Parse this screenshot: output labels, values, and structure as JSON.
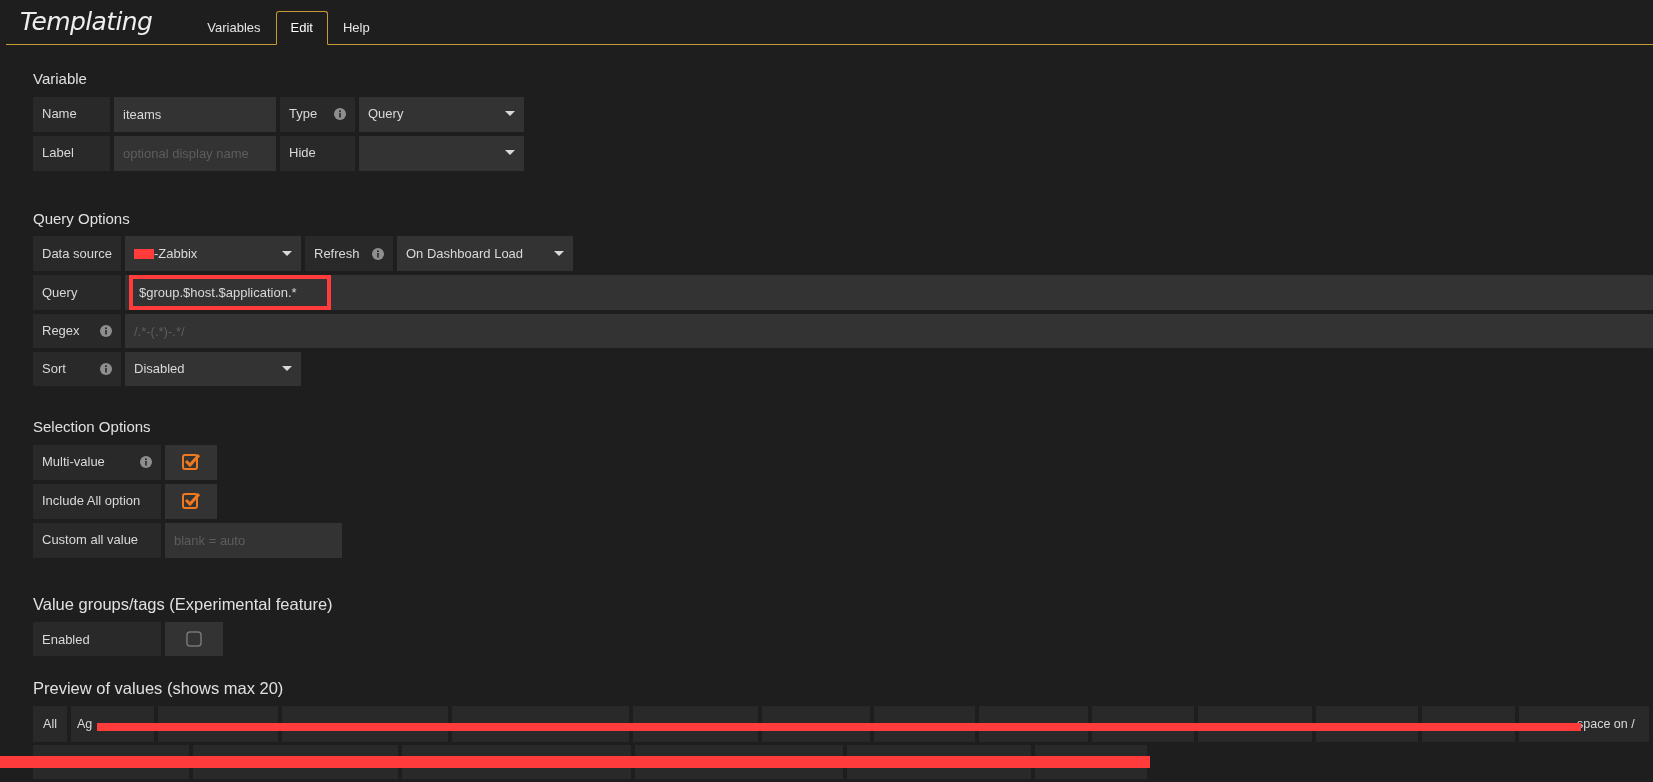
{
  "header": {
    "title": "Templating",
    "tabs": [
      {
        "label": "Variables",
        "selected": false
      },
      {
        "label": "Edit",
        "selected": true
      },
      {
        "label": "Help",
        "selected": false
      }
    ]
  },
  "variable": {
    "heading": "Variable",
    "name_label": "Name",
    "name_value": "iteams",
    "type_label": "Type",
    "type_value": "Query",
    "label_label": "Label",
    "label_placeholder": "optional display name",
    "hide_label": "Hide"
  },
  "query_options": {
    "heading": "Query Options",
    "datasource_label": "Data source",
    "datasource_value": "-Zabbix",
    "datasource_redacted": true,
    "refresh_label": "Refresh",
    "refresh_value": "On Dashboard Load",
    "query_label": "Query",
    "query_value": "$group.$host.$application.*",
    "query_highlighted": true,
    "regex_label": "Regex",
    "regex_placeholder": "/.*-(.*)-.*/",
    "sort_label": "Sort",
    "sort_value": "Disabled"
  },
  "selection_options": {
    "heading": "Selection Options",
    "rows": [
      {
        "kind": "checkbox",
        "label": "Multi-value",
        "info": true,
        "checked": true
      },
      {
        "kind": "checkbox",
        "label": "Include All option",
        "info": false,
        "checked": true
      },
      {
        "kind": "field",
        "label": "Custom all value",
        "placeholder": "blank = auto"
      }
    ]
  },
  "value_groups": {
    "heading": "Value groups/tags (Experimental feature)",
    "enabled_label": "Enabled",
    "enabled": false
  },
  "preview": {
    "heading": "Preview of values (shows max 20)",
    "redacted": true,
    "values": [
      {
        "kind": "visible",
        "text": "All"
      },
      {
        "kind": "partly_covered",
        "text": "Ag"
      },
      {
        "kind": "covered"
      },
      {
        "kind": "covered"
      },
      {
        "kind": "covered"
      },
      {
        "kind": "covered"
      },
      {
        "kind": "covered"
      },
      {
        "kind": "covered"
      },
      {
        "kind": "covered"
      },
      {
        "kind": "covered"
      },
      {
        "kind": "covered"
      },
      {
        "kind": "covered"
      },
      {
        "kind": "covered"
      },
      {
        "kind": "partly_covered",
        "text": "space on /"
      }
    ],
    "covered_values": [
      {
        "kind": "covered"
      },
      {
        "kind": "covered"
      },
      {
        "kind": "covered"
      },
      {
        "kind": "covered"
      },
      {
        "kind": "covered"
      },
      {
        "kind": "covered"
      }
    ]
  }
}
